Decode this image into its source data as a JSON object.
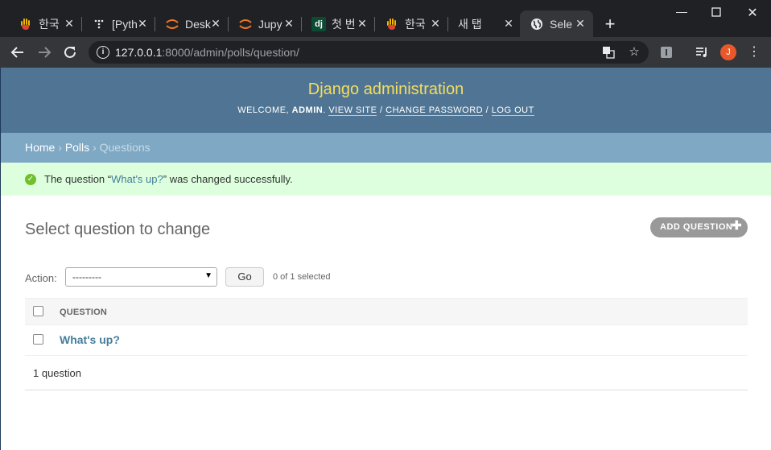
{
  "browser": {
    "tabs": [
      {
        "title": "한국",
        "icon": "hand-icon"
      },
      {
        "title": "[Pyth",
        "icon": "dots-icon"
      },
      {
        "title": "Desk",
        "icon": "jupyter-icon"
      },
      {
        "title": "Jupy",
        "icon": "jupyter-icon"
      },
      {
        "title": "첫 번",
        "icon": "django-icon",
        "icon_text": "dj"
      },
      {
        "title": "한국",
        "icon": "hand-icon"
      },
      {
        "title": "새 탭",
        "icon": ""
      },
      {
        "title": "Sele",
        "icon": "globe-icon",
        "active": true
      }
    ],
    "url_host": "127.0.0.1",
    "url_rest": ":8000/admin/polls/question/",
    "avatar_letter": "J"
  },
  "admin": {
    "site_name": "Django administration",
    "welcome": "WELCOME,",
    "username": "ADMIN",
    "view_site": "VIEW SITE",
    "change_password": "CHANGE PASSWORD",
    "log_out": "LOG OUT",
    "breadcrumbs": {
      "home": "Home",
      "app": "Polls",
      "current": "Questions"
    },
    "message": {
      "prefix": "The question “",
      "object": "What's up?",
      "suffix": "” was changed successfully."
    },
    "title": "Select question to change",
    "add_button": "ADD QUESTION",
    "action_label": "Action:",
    "action_value": "---------",
    "go_button": "Go",
    "selected_counter": "0 of 1 selected",
    "column_header": "QUESTION",
    "rows": [
      {
        "question": "What's up?"
      }
    ],
    "paginator": "1 question"
  },
  "colors": {
    "header_bg": "#507594",
    "site_name": "#f5dd5d",
    "breadcrumbs_bg": "#7fa8c5",
    "success_bg": "#ddffdd",
    "link": "#447e9b"
  }
}
